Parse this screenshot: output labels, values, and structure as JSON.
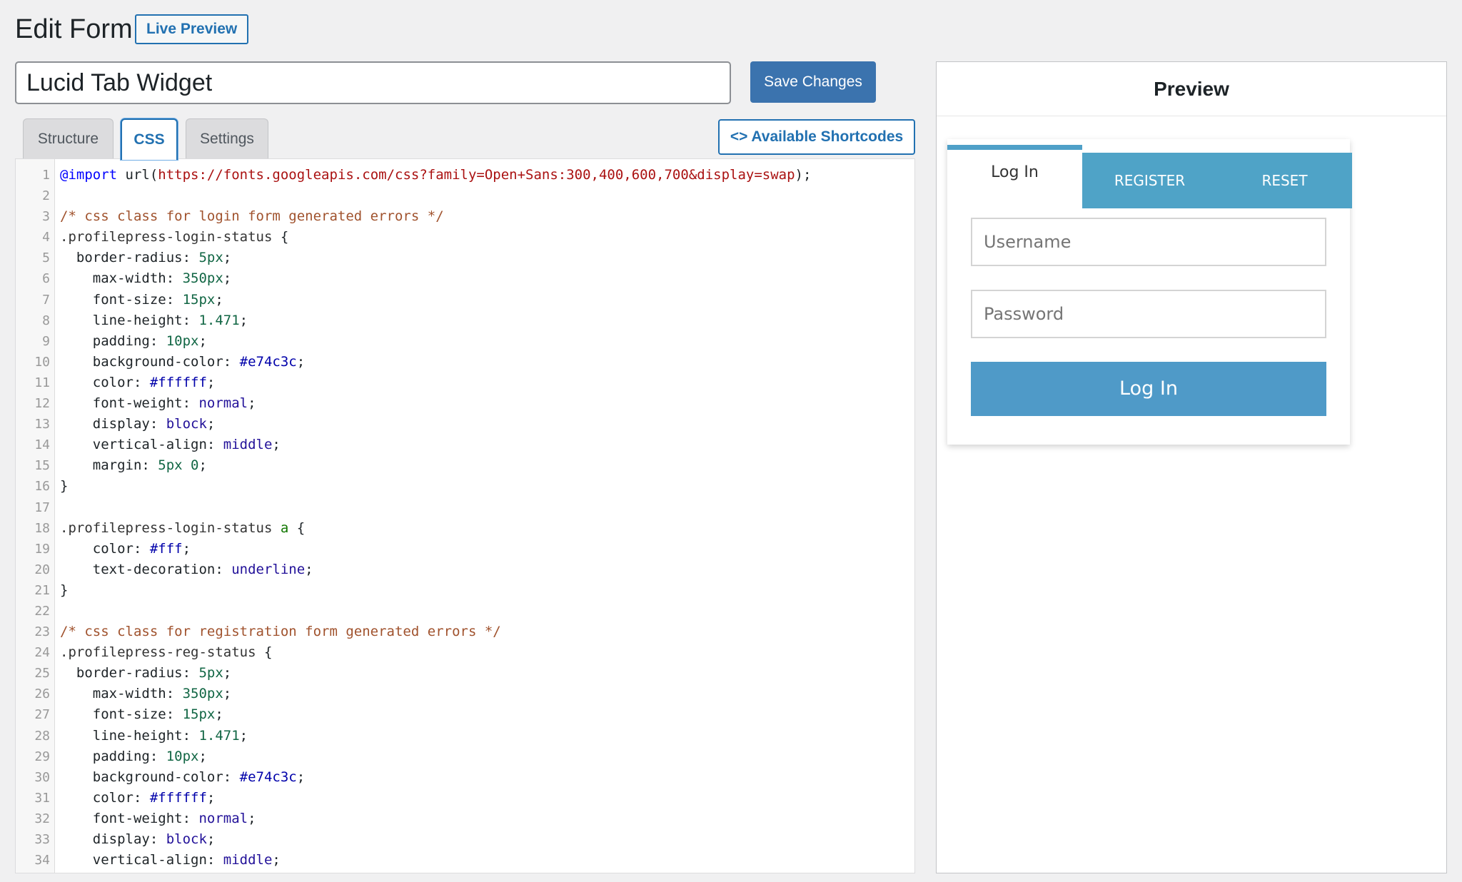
{
  "header": {
    "title": "Edit Form",
    "live_preview_label": "Live Preview"
  },
  "form": {
    "name_value": "Lucid Tab Widget",
    "save_label": "Save Changes"
  },
  "tabs": [
    {
      "label": "Structure",
      "active": false
    },
    {
      "label": "CSS",
      "active": true
    },
    {
      "label": "Settings",
      "active": false
    }
  ],
  "shortcodes_label": "<> Available Shortcodes",
  "editor": {
    "lines": [
      [
        {
          "t": "@import",
          "c": "t-def"
        },
        {
          "t": " url(",
          "c": "t-prop"
        },
        {
          "t": "https://fonts.googleapis.com/css?family=Open+Sans:300,400,600,700&display=swap",
          "c": "t-url"
        },
        {
          "t": ");",
          "c": "t-prop"
        }
      ],
      [],
      [
        {
          "t": "/* css class for login form generated errors */",
          "c": "t-com"
        }
      ],
      [
        {
          "t": ".profilepress-login-status",
          "c": "t-sel"
        },
        {
          "t": " {",
          "c": "t-prop"
        }
      ],
      [
        {
          "t": "  border-radius: ",
          "c": "t-prop"
        },
        {
          "t": "5px",
          "c": "t-num"
        },
        {
          "t": ";",
          "c": "t-prop"
        }
      ],
      [
        {
          "t": "    max-width: ",
          "c": "t-prop"
        },
        {
          "t": "350px",
          "c": "t-num"
        },
        {
          "t": ";",
          "c": "t-prop"
        }
      ],
      [
        {
          "t": "    font-size: ",
          "c": "t-prop"
        },
        {
          "t": "15px",
          "c": "t-num"
        },
        {
          "t": ";",
          "c": "t-prop"
        }
      ],
      [
        {
          "t": "    line-height: ",
          "c": "t-prop"
        },
        {
          "t": "1.471",
          "c": "t-num"
        },
        {
          "t": ";",
          "c": "t-prop"
        }
      ],
      [
        {
          "t": "    padding: ",
          "c": "t-prop"
        },
        {
          "t": "10px",
          "c": "t-num"
        },
        {
          "t": ";",
          "c": "t-prop"
        }
      ],
      [
        {
          "t": "    background-color: ",
          "c": "t-prop"
        },
        {
          "t": "#e74c3c",
          "c": "t-hex"
        },
        {
          "t": ";",
          "c": "t-prop"
        }
      ],
      [
        {
          "t": "    color: ",
          "c": "t-prop"
        },
        {
          "t": "#ffffff",
          "c": "t-hex"
        },
        {
          "t": ";",
          "c": "t-prop"
        }
      ],
      [
        {
          "t": "    font-weight: ",
          "c": "t-prop"
        },
        {
          "t": "normal",
          "c": "t-kw"
        },
        {
          "t": ";",
          "c": "t-prop"
        }
      ],
      [
        {
          "t": "    display: ",
          "c": "t-prop"
        },
        {
          "t": "block",
          "c": "t-kw"
        },
        {
          "t": ";",
          "c": "t-prop"
        }
      ],
      [
        {
          "t": "    vertical-align: ",
          "c": "t-prop"
        },
        {
          "t": "middle",
          "c": "t-kw"
        },
        {
          "t": ";",
          "c": "t-prop"
        }
      ],
      [
        {
          "t": "    margin: ",
          "c": "t-prop"
        },
        {
          "t": "5px 0",
          "c": "t-num"
        },
        {
          "t": ";",
          "c": "t-prop"
        }
      ],
      [
        {
          "t": "}",
          "c": "t-prop"
        }
      ],
      [],
      [
        {
          "t": ".profilepress-login-status ",
          "c": "t-sel"
        },
        {
          "t": "a",
          "c": "t-tag"
        },
        {
          "t": " {",
          "c": "t-prop"
        }
      ],
      [
        {
          "t": "    color: ",
          "c": "t-prop"
        },
        {
          "t": "#fff",
          "c": "t-hex"
        },
        {
          "t": ";",
          "c": "t-prop"
        }
      ],
      [
        {
          "t": "    text-decoration: ",
          "c": "t-prop"
        },
        {
          "t": "underline",
          "c": "t-kw"
        },
        {
          "t": ";",
          "c": "t-prop"
        }
      ],
      [
        {
          "t": "}",
          "c": "t-prop"
        }
      ],
      [],
      [
        {
          "t": "/* css class for registration form generated errors */",
          "c": "t-com"
        }
      ],
      [
        {
          "t": ".profilepress-reg-status",
          "c": "t-sel"
        },
        {
          "t": " {",
          "c": "t-prop"
        }
      ],
      [
        {
          "t": "  border-radius: ",
          "c": "t-prop"
        },
        {
          "t": "5px",
          "c": "t-num"
        },
        {
          "t": ";",
          "c": "t-prop"
        }
      ],
      [
        {
          "t": "    max-width: ",
          "c": "t-prop"
        },
        {
          "t": "350px",
          "c": "t-num"
        },
        {
          "t": ";",
          "c": "t-prop"
        }
      ],
      [
        {
          "t": "    font-size: ",
          "c": "t-prop"
        },
        {
          "t": "15px",
          "c": "t-num"
        },
        {
          "t": ";",
          "c": "t-prop"
        }
      ],
      [
        {
          "t": "    line-height: ",
          "c": "t-prop"
        },
        {
          "t": "1.471",
          "c": "t-num"
        },
        {
          "t": ";",
          "c": "t-prop"
        }
      ],
      [
        {
          "t": "    padding: ",
          "c": "t-prop"
        },
        {
          "t": "10px",
          "c": "t-num"
        },
        {
          "t": ";",
          "c": "t-prop"
        }
      ],
      [
        {
          "t": "    background-color: ",
          "c": "t-prop"
        },
        {
          "t": "#e74c3c",
          "c": "t-hex"
        },
        {
          "t": ";",
          "c": "t-prop"
        }
      ],
      [
        {
          "t": "    color: ",
          "c": "t-prop"
        },
        {
          "t": "#ffffff",
          "c": "t-hex"
        },
        {
          "t": ";",
          "c": "t-prop"
        }
      ],
      [
        {
          "t": "    font-weight: ",
          "c": "t-prop"
        },
        {
          "t": "normal",
          "c": "t-kw"
        },
        {
          "t": ";",
          "c": "t-prop"
        }
      ],
      [
        {
          "t": "    display: ",
          "c": "t-prop"
        },
        {
          "t": "block",
          "c": "t-kw"
        },
        {
          "t": ";",
          "c": "t-prop"
        }
      ],
      [
        {
          "t": "    vertical-align: ",
          "c": "t-prop"
        },
        {
          "t": "middle",
          "c": "t-kw"
        },
        {
          "t": ";",
          "c": "t-prop"
        }
      ]
    ]
  },
  "preview": {
    "title": "Preview",
    "tabs": {
      "login": "Log In",
      "register": "REGISTER",
      "reset": "RESET"
    },
    "username_placeholder": "Username",
    "password_placeholder": "Password",
    "submit_label": "Log In"
  },
  "colors": {
    "accent": "#2271b1",
    "save_button": "#3b73ae",
    "widget_tab": "#4fa3c7",
    "widget_button": "#4f9ac8"
  }
}
